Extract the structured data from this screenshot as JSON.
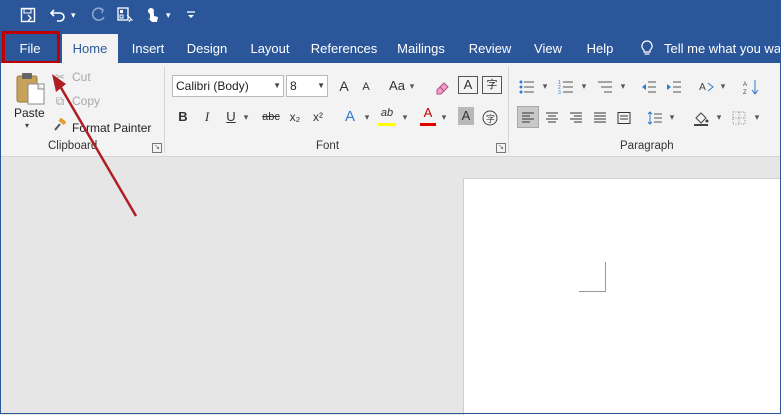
{
  "quick_access": {
    "icons": [
      "save-icon",
      "undo-icon",
      "redo-icon",
      "form-icon",
      "touch-mode-icon",
      "customize-icon"
    ]
  },
  "tabs": [
    {
      "label": "File"
    },
    {
      "label": "Home"
    },
    {
      "label": "Insert"
    },
    {
      "label": "Design"
    },
    {
      "label": "Layout"
    },
    {
      "label": "References"
    },
    {
      "label": "Mailings"
    },
    {
      "label": "Review"
    },
    {
      "label": "View"
    },
    {
      "label": "Help"
    }
  ],
  "tell_me": "Tell me what you war",
  "clipboard": {
    "paste_label": "Paste",
    "cut_label": "Cut",
    "copy_label": "Copy",
    "format_painter_label": "Format Painter",
    "group_label": "Clipboard"
  },
  "font": {
    "font_name": "Calibri (Body)",
    "font_size": "8",
    "group_label": "Font",
    "buttons": {
      "bold": "B",
      "italic": "I",
      "underline": "U",
      "strike": "abc",
      "subscript": "x₂",
      "superscript": "x²",
      "grow": "A",
      "shrink": "A",
      "case": "Aa",
      "text_effects": "A",
      "highlight": "ab",
      "font_color": "A",
      "shade": "A",
      "enclose": "字"
    }
  },
  "paragraph": {
    "group_label": "Paragraph"
  },
  "colors": {
    "accent": "#2b579a",
    "highlight_box": "#c00000",
    "arrow": "#b01d23"
  }
}
